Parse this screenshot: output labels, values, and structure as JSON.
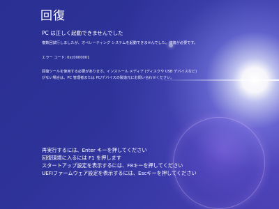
{
  "screen": {
    "title": "回復",
    "headline": "PC は正しく起動できませんでした",
    "detail": "複数回試行しましたが、オペレーティング システムを起動できませんでした。修復が必要です。",
    "error_code": "エラー コード: 0xc0000001",
    "tool_line1": "回復ツールを使用する必要があります。インストール メディア (ディスクや USB デバイスなど)",
    "tool_line2": "がない場合は、PC 管理者または PC/デバイスの製造元にお問い合わせください。"
  },
  "options": [
    {
      "label": "再実行するには、Enter キーを押してください"
    },
    {
      "label": "回復環境に入るには F1 を押します"
    },
    {
      "label": "スタートアップ設定を表示するには、F8キーを押してください"
    },
    {
      "label": "UEFIファームウェア設定を表示するには、Escキーを押してください"
    }
  ],
  "colors": {
    "background": "#2b2f96",
    "text": "#ffffff",
    "flare": "#ffffff"
  }
}
